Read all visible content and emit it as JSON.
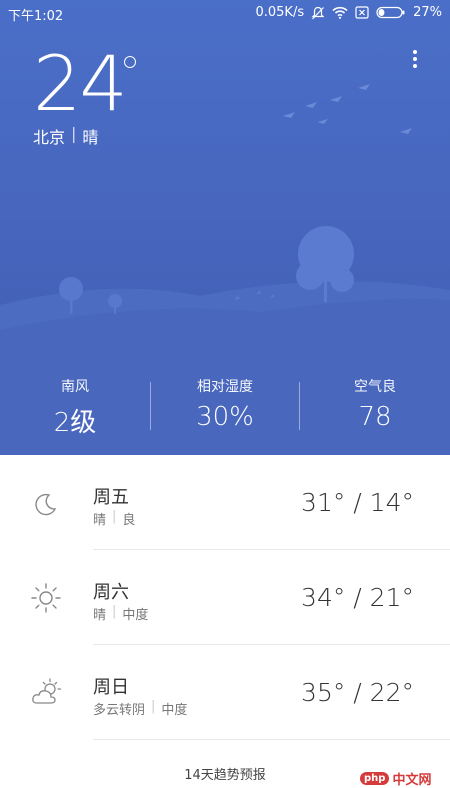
{
  "status_bar": {
    "time": "下午1:02",
    "net_speed": "0.05K/s",
    "battery": "27%",
    "battery_level": 0.27
  },
  "current": {
    "temperature": "24",
    "city": "北京",
    "separator": "|",
    "condition": "晴"
  },
  "stats": [
    {
      "label": "南风",
      "value": "2级"
    },
    {
      "label": "相对湿度",
      "value": "30%"
    },
    {
      "label": "空气良",
      "value": "78"
    }
  ],
  "forecast": [
    {
      "day": "周五",
      "desc": [
        "晴",
        "良"
      ],
      "temps": "31° / 14°",
      "icon": "moon-icon"
    },
    {
      "day": "周六",
      "desc": [
        "晴",
        "中度"
      ],
      "temps": "34° / 21°",
      "icon": "sun-icon"
    },
    {
      "day": "周日",
      "desc": [
        "多云转阴",
        "中度"
      ],
      "temps": "35° / 22°",
      "icon": "partly-cloudy-icon"
    }
  ],
  "trend_link": "14天趋势预报",
  "watermark": {
    "badge": "php",
    "text": "中文网"
  },
  "colors": {
    "sky_top": "#4a6fc8",
    "sky_bottom": "#3f5cb0",
    "hill": "#5677cc",
    "text_dark": "#333333"
  }
}
